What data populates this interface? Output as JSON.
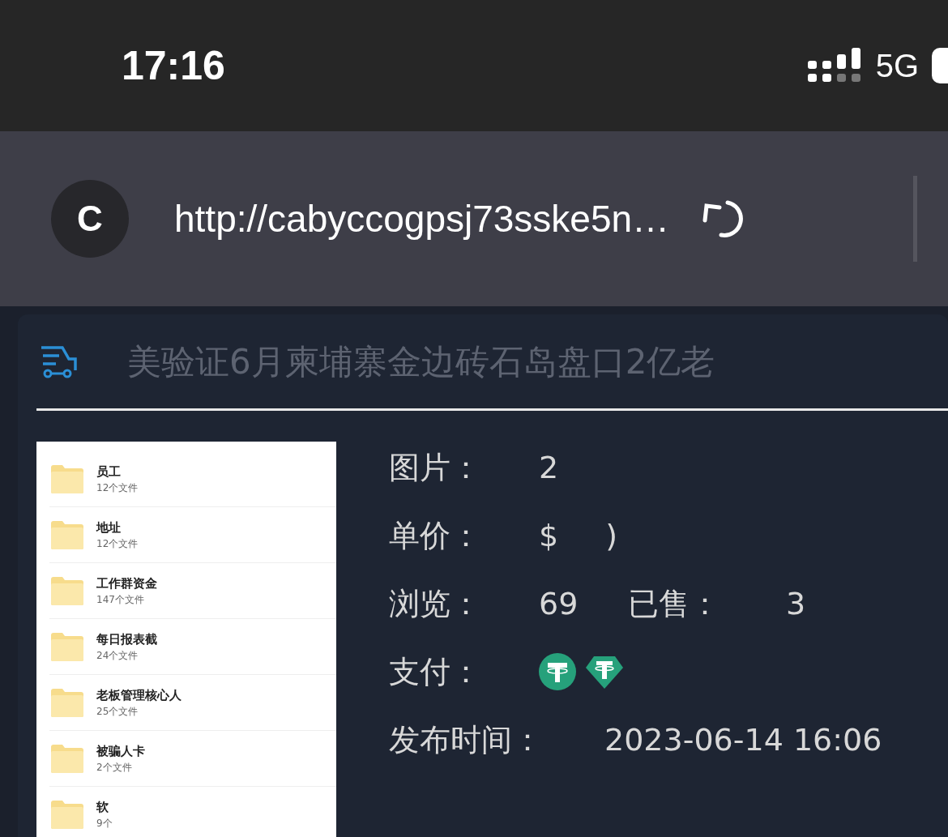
{
  "status_bar": {
    "time": "17:16",
    "network": "5G"
  },
  "address_bar": {
    "site_letter": "C",
    "url": "http://cabyccogpsj73sske5n…"
  },
  "listing": {
    "title": "美验证6月柬埔寨金边砖石岛盘口2亿老",
    "preview": [
      {
        "name": "员工",
        "count": "12个文件"
      },
      {
        "name": "地址",
        "count": "12个文件"
      },
      {
        "name": "工作群资金",
        "count": "147个文件"
      },
      {
        "name": "每日报表截",
        "count": "24个文件"
      },
      {
        "name": "老板管理核心人",
        "count": "25个文件"
      },
      {
        "name": "被骗人卡",
        "count": "2个文件"
      },
      {
        "name": "软",
        "count": "9个"
      }
    ],
    "details": [
      {
        "kind": "text",
        "label": "图片：",
        "value": "2"
      },
      {
        "kind": "price",
        "label": "单价：",
        "currency": "$",
        "value": ")"
      },
      {
        "kind": "pair",
        "label": "浏览：",
        "value": "69",
        "label_2": "已售：",
        "value_2": "3"
      },
      {
        "kind": "payment",
        "label": "支付："
      },
      {
        "kind": "date",
        "label": "发布时间：",
        "value": "2023-06-14 16:06"
      }
    ]
  }
}
